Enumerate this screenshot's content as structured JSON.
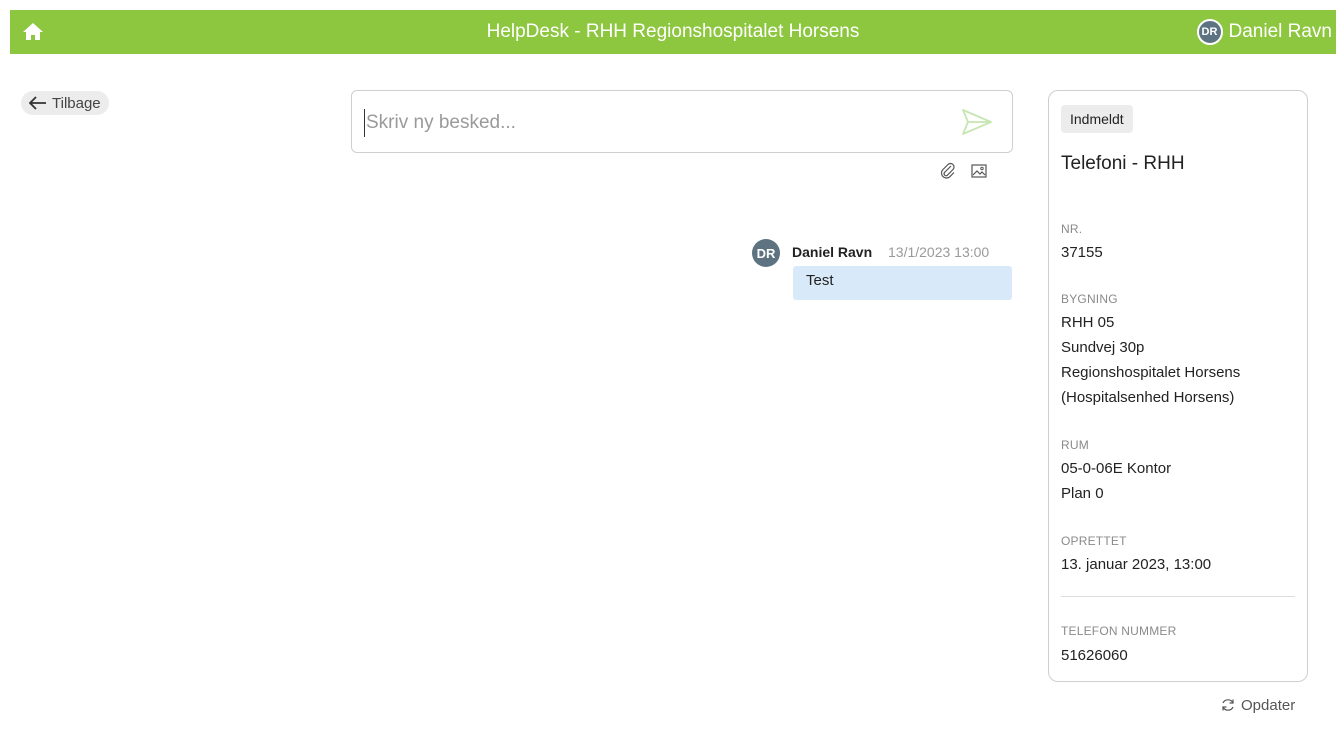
{
  "header": {
    "title": "HelpDesk - RHH Regionshospitalet Horsens",
    "user_initials": "DR",
    "user_name": "Daniel Ravn",
    "bar_color": "#8dc63f",
    "home_icon": "home-icon"
  },
  "nav": {
    "back_label": "Tilbage",
    "back_icon": "arrow-left-icon"
  },
  "compose": {
    "placeholder": "Skriv ny besked...",
    "value": "",
    "send_icon": "send-icon",
    "attach_icon": "paperclip-icon",
    "image_icon": "image-icon"
  },
  "messages": [
    {
      "initials": "DR",
      "author": "Daniel Ravn",
      "timestamp": "13/1/2023 13:00",
      "text": "Test"
    }
  ],
  "ticket": {
    "status": "Indmeldt",
    "title": "Telefoni - RHH",
    "fields": {
      "nr_label": "NR.",
      "nr_value": "37155",
      "building_label": "BYGNING",
      "building_lines": [
        "RHH 05",
        "Sundvej 30p",
        "Regionshospitalet Horsens",
        "(Hospitalsenhed Horsens)"
      ],
      "room_label": "RUM",
      "room_lines": [
        "05-0-06E Kontor",
        "Plan 0"
      ],
      "created_label": "OPRETTET",
      "created_value": "13. januar 2023, 13:00",
      "phone_label": "TELEFON NUMMER",
      "phone_value": "51626060"
    }
  },
  "actions": {
    "refresh_label": "Opdater",
    "refresh_icon": "refresh-icon"
  }
}
